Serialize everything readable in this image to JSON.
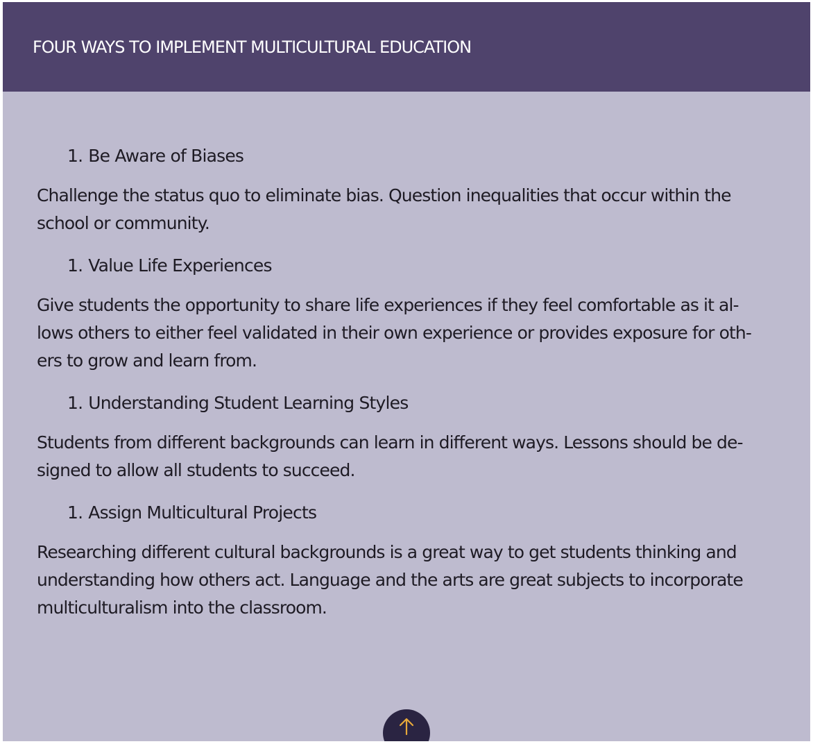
{
  "header": {
    "title": "FOUR WAYS TO IMPLEMENT MULTICULTURAL EDUCATION"
  },
  "items": [
    {
      "number": "1.",
      "heading": "Be Aware of Biases",
      "lines": [
        "Challenge the status quo to eliminate bias.  Question inequalities that occur within the",
        "school or community."
      ]
    },
    {
      "number": "1.",
      "heading": "Value Life Experiences",
      "lines": [
        "Give students the opportunity to share life experiences if they feel comfortable as it al-",
        "lows others to either feel validated in their own experience or provides exposure for oth-",
        "ers to grow and learn from."
      ]
    },
    {
      "number": "1.",
      "heading": "Understanding Student Learning Styles",
      "lines": [
        "Students from different backgrounds can learn in different ways.  Lessons should be de-",
        "signed to allow all students to succeed."
      ]
    },
    {
      "number": "1.",
      "heading": "Assign Multicultural Projects",
      "lines": [
        "Researching different cultural backgrounds is a great way to get students thinking and",
        "understanding how others act.  Language and the arts are great subjects to incorporate",
        "multiculturalism into the classroom."
      ]
    }
  ],
  "back_to_top": {
    "icon": "arrow-up-icon"
  },
  "colors": {
    "header_bg": "#4f436c",
    "content_bg": "#bebbcf",
    "button_bg": "#2a2442",
    "arrow": "#e8a93a",
    "text": "#1e1b24"
  }
}
